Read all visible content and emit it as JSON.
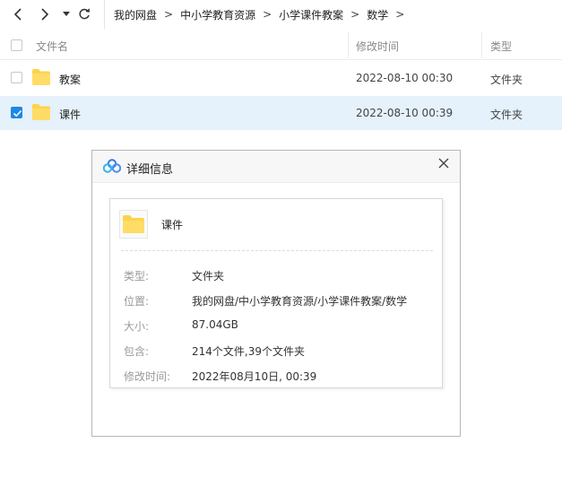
{
  "toolbar": {
    "breadcrumb": [
      "我的网盘",
      "中小学教育资源",
      "小学课件教案",
      "数学"
    ],
    "separator": ">"
  },
  "list": {
    "columns": [
      "文件名",
      "修改时间",
      "类型"
    ],
    "rows": [
      {
        "name": "教案",
        "modified": "2022-08-10 00:30",
        "type": "文件夹",
        "selected": false
      },
      {
        "name": "课件",
        "modified": "2022-08-10 00:39",
        "type": "文件夹",
        "selected": true
      }
    ]
  },
  "dialog": {
    "title": "详细信息",
    "name": "课件",
    "fields": [
      {
        "label": "类型:",
        "value": "文件夹"
      },
      {
        "label": "位置:",
        "value": "我的网盘/中小学教育资源/小学课件教案/数学"
      },
      {
        "label": "大小:",
        "value": "87.04GB"
      },
      {
        "label": "包含:",
        "value": "214个文件,39个文件夹"
      },
      {
        "label": "修改时间:",
        "value": "2022年08月10日, 00:39"
      }
    ]
  },
  "colors": {
    "accent": "#1e88e5",
    "selected_row": "#e5f1fb",
    "folder": "#ffd24d"
  }
}
